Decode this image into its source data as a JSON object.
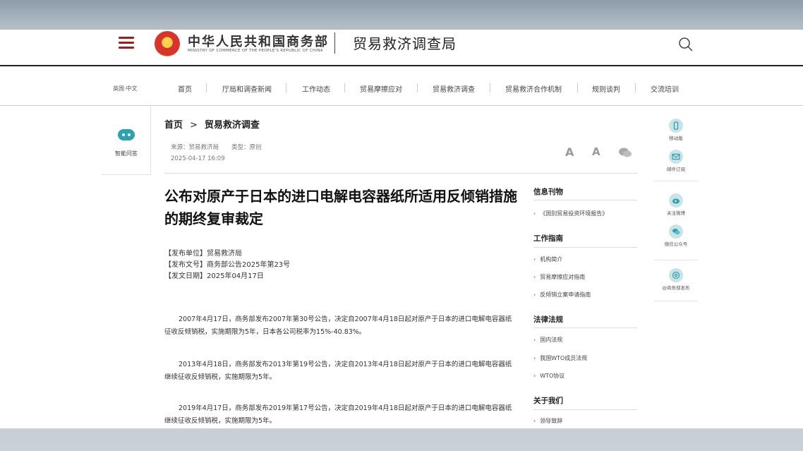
{
  "header": {
    "ministry_cn": "中华人民共和国商务部",
    "ministry_en": "MINISTRY OF COMMERCE OF THE PEOPLE'S REPUBLIC OF CHINA",
    "bureau_title": "贸易救济调查局"
  },
  "nav": {
    "items": [
      "英国·中文",
      "首页",
      "厅局和调查新闻",
      "工作动态",
      "贸易摩擦应对",
      "贸易救济调查",
      "贸易救济合作机制",
      "规则谈判",
      "交流培训"
    ]
  },
  "left_rail": {
    "robot_label": "智能问答"
  },
  "breadcrumb": {
    "home": "首页",
    "sep": ">",
    "current": "贸易救济调查"
  },
  "meta": {
    "source": "来源：贸易救济局",
    "type": "类型：原创",
    "datetime": "2025-04-17 16:09"
  },
  "font_controls": {
    "large": "A",
    "small": "A"
  },
  "article": {
    "title": "公布对原产于日本的进口电解电容器纸所适用反倾销措施的期终复审裁定",
    "pub_unit": "【发布单位】贸易救济局",
    "pub_no": "【发布文号】商务部公告2025年第23号",
    "pub_date": "【发文日期】2025年04月17日",
    "paragraphs": [
      "2007年4月17日，商务部发布2007年第30号公告，决定自2007年4月18日起对原产于日本的进口电解电容器纸征收反倾销税，实施期限为5年，日本各公司税率为15%-40.83%。",
      "2013年4月18日，商务部发布2013年第19号公告，决定自2013年4月18日起对原产于日本的进口电解电容器纸继续征收反倾销税，实施期限为5年。",
      "2019年4月17日，商务部发布2019年第17号公告，决定自2019年4月18日起对原产于日本的进口电解电容器纸继续征收反倾销税，实施期限为5年。"
    ]
  },
  "sidebar": {
    "sections": [
      {
        "title": "信息刊物",
        "links": [
          "《国别贸易投资环境报告》"
        ]
      },
      {
        "title": "工作指南",
        "links": [
          "机构简介",
          "贸易摩擦应对指南",
          "反倾销立案申请指南"
        ]
      },
      {
        "title": "法律法规",
        "links": [
          "国内法规",
          "我国WTO成员法规",
          "WTO协议"
        ]
      },
      {
        "title": "关于我们",
        "links": [
          "领导致辞"
        ]
      }
    ]
  },
  "right_rail": {
    "items": [
      "移动版",
      "邮件订阅",
      "关注微博",
      "微信公众号",
      "@商务部发布"
    ]
  },
  "colors": {
    "accent_red": "#a31d1d",
    "icon_teal": "#2aa3b0"
  }
}
